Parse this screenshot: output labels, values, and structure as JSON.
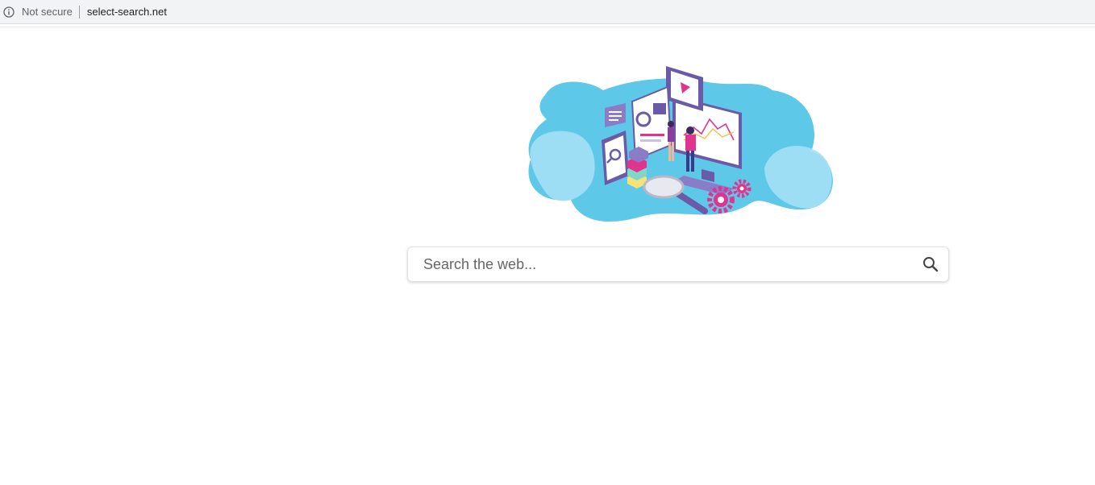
{
  "browser": {
    "security_label": "Not secure",
    "url": "select-search.net",
    "info_icon": "info-icon"
  },
  "hero": {
    "illustration": "data-analytics-illustration"
  },
  "search": {
    "placeholder": "Search the web...",
    "value": "",
    "button_icon": "search-icon"
  },
  "colors": {
    "blob_blue": "#5ec8e8",
    "blob_light_blue": "#a5e0f5",
    "accent_purple": "#6a5aa8",
    "accent_pink": "#e0348f",
    "accent_yellow": "#f5e37a",
    "accent_teal": "#7ed8c8"
  }
}
